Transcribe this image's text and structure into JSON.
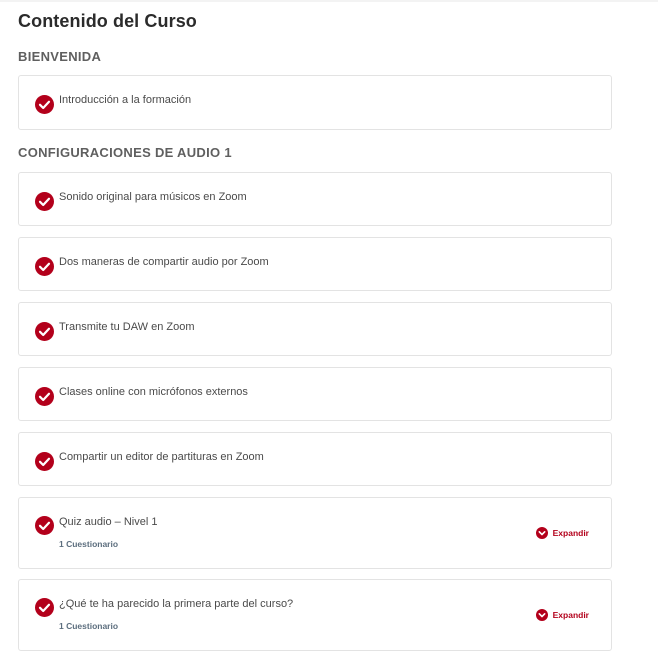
{
  "page_title": "Contenido del Curso",
  "sections": [
    {
      "title": "BIENVENIDA"
    },
    {
      "title": "CONFIGURACIONES DE AUDIO 1"
    }
  ],
  "lessons": [
    {
      "title": "Introducción a la formación"
    },
    {
      "title": "Sonido original para músicos en Zoom"
    },
    {
      "title": "Dos maneras de compartir audio por Zoom"
    },
    {
      "title": "Transmite tu DAW en Zoom"
    },
    {
      "title": "Clases online con micrófonos externos"
    },
    {
      "title": "Compartir un editor de partituras en Zoom"
    },
    {
      "title": "Quiz audio – Nivel 1",
      "meta": "1 Cuestionario",
      "expand": "Expandir"
    },
    {
      "title": "¿Qué te ha parecido la primera parte del curso?",
      "meta": "1 Cuestionario",
      "expand": "Expandir"
    }
  ],
  "colors": {
    "accent": "#b3001b",
    "meta": "#5c6e7e",
    "border": "#e3e3e3"
  },
  "icons": {
    "complete": "check-circle-icon",
    "expand": "chevron-down-icon"
  }
}
